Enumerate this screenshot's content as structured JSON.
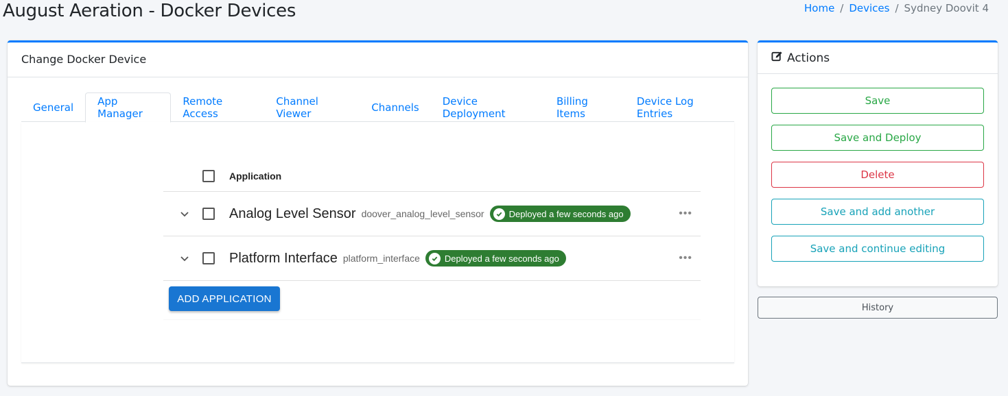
{
  "page": {
    "title": "August Aeration - Docker Devices"
  },
  "breadcrumb": {
    "items": [
      {
        "label": "Home"
      },
      {
        "label": "Devices"
      },
      {
        "label": "Sydney Doovit 4"
      }
    ],
    "separator": "/"
  },
  "main": {
    "header": "Change Docker Device",
    "tabs": [
      {
        "label": "General",
        "active": false
      },
      {
        "label": "App Manager",
        "active": true
      },
      {
        "label": "Remote Access",
        "active": false
      },
      {
        "label": "Channel Viewer",
        "active": false
      },
      {
        "label": "Channels",
        "active": false
      },
      {
        "label": "Device Deployment",
        "active": false
      },
      {
        "label": "Billing Items",
        "active": false
      },
      {
        "label": "Device Log Entries",
        "active": false
      }
    ],
    "app_table": {
      "column_header": "Application",
      "rows": [
        {
          "name": "Analog Level Sensor",
          "id": "doover_analog_level_sensor",
          "status": "Deployed a few seconds ago"
        },
        {
          "name": "Platform Interface",
          "id": "platform_interface",
          "status": "Deployed a few seconds ago"
        }
      ],
      "add_button": "ADD APPLICATION",
      "more_icon": "ellipsis-icon"
    }
  },
  "actions": {
    "header": "Actions",
    "header_icon": "edit-icon",
    "buttons": {
      "save": "Save",
      "save_deploy": "Save and Deploy",
      "delete": "Delete",
      "save_add": "Save and add another",
      "save_continue": "Save and continue editing"
    },
    "history": "History"
  },
  "colors": {
    "primary": "#007bff",
    "success": "#28a745",
    "danger": "#dc3545",
    "info": "#17a2b8",
    "badge_green": "#2e7d32",
    "mui_blue": "#1976d2"
  }
}
